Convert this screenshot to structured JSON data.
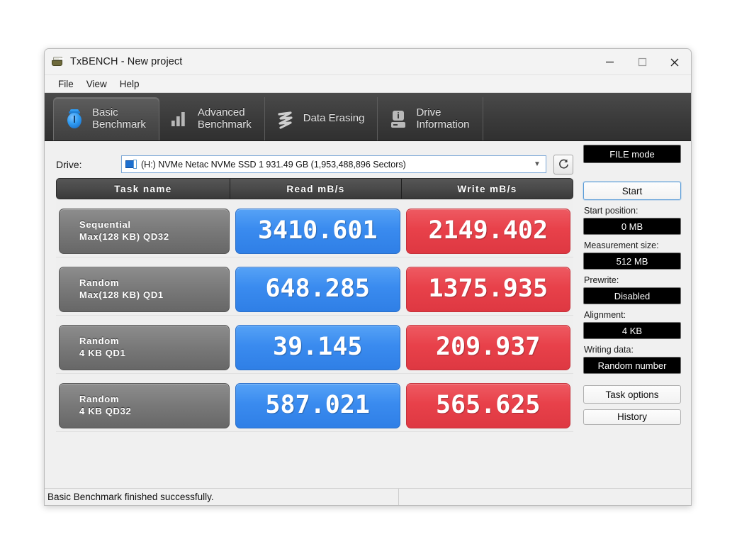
{
  "window": {
    "title": "TxBENCH - New project",
    "app_icon": "txbench-icon",
    "controls": {
      "minimize": "minimize-icon",
      "maximize": "maximize-icon",
      "close": "close-icon"
    }
  },
  "menu": {
    "items": [
      "File",
      "View",
      "Help"
    ]
  },
  "tabs": [
    {
      "label": "Basic\nBenchmark",
      "icon": "stopwatch-icon",
      "active": true
    },
    {
      "label": "Advanced\nBenchmark",
      "icon": "bar-chart-icon",
      "active": false
    },
    {
      "label": "Data Erasing",
      "icon": "shredder-icon",
      "active": false
    },
    {
      "label": "Drive\nInformation",
      "icon": "drive-info-icon",
      "active": false
    }
  ],
  "drive": {
    "label": "Drive:",
    "selected": "(H:) NVMe Netac NVMe SSD 1  931.49 GB (1,953,488,896 Sectors)",
    "caret": "▼",
    "icon": "drive-icon",
    "refresh_icon": "refresh-icon"
  },
  "table": {
    "headers": {
      "task": "Task name",
      "read": "Read mB/s",
      "write": "Write mB/s"
    },
    "rows": [
      {
        "task_line1": "Sequential",
        "task_line2": "Max(128 KB) QD32",
        "read": "3410.601",
        "write": "2149.402"
      },
      {
        "task_line1": "Random",
        "task_line2": "Max(128 KB) QD1",
        "read": "648.285",
        "write": "1375.935"
      },
      {
        "task_line1": "Random",
        "task_line2": "4 KB QD1",
        "read": "39.145",
        "write": "209.937"
      },
      {
        "task_line1": "Random",
        "task_line2": "4 KB QD32",
        "read": "587.021",
        "write": "565.625"
      }
    ]
  },
  "sidebar": {
    "file_mode": "FILE mode",
    "start_button": "Start",
    "start_position_label": "Start position:",
    "start_position_value": "0 MB",
    "measurement_size_label": "Measurement size:",
    "measurement_size_value": "512 MB",
    "prewrite_label": "Prewrite:",
    "prewrite_value": "Disabled",
    "alignment_label": "Alignment:",
    "alignment_value": "4 KB",
    "writing_data_label": "Writing data:",
    "writing_data_value": "Random number",
    "task_options_button": "Task options",
    "history_button": "History"
  },
  "status": {
    "message": "Basic Benchmark finished successfully."
  },
  "colors": {
    "read_blue": "#3a8bef",
    "write_red": "#e8414a",
    "tab_strip": "#3c3c3c",
    "header_grey": "#4a4a4a",
    "task_cell_grey": "#7a7a7a",
    "window_bg": "#f0f0f0"
  }
}
